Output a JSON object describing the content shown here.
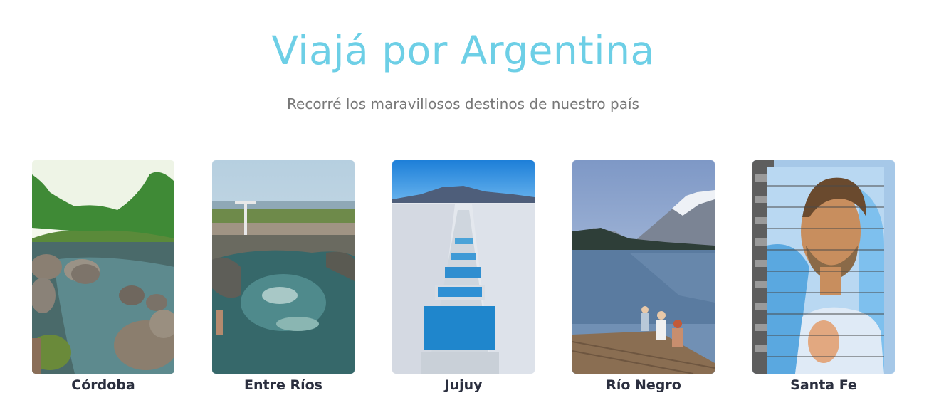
{
  "header": {
    "title": "Viajá por Argentina",
    "subtitle": "Recorré los maravillosos destinos de nuestro país"
  },
  "destinations": [
    {
      "name": "Córdoba"
    },
    {
      "name": "Entre Ríos"
    },
    {
      "name": "Jujuy"
    },
    {
      "name": "Río Negro"
    },
    {
      "name": "Santa Fe"
    }
  ],
  "colors": {
    "title": "#6dcfe6",
    "subtitle": "#777777",
    "label": "#2b2f3f"
  }
}
